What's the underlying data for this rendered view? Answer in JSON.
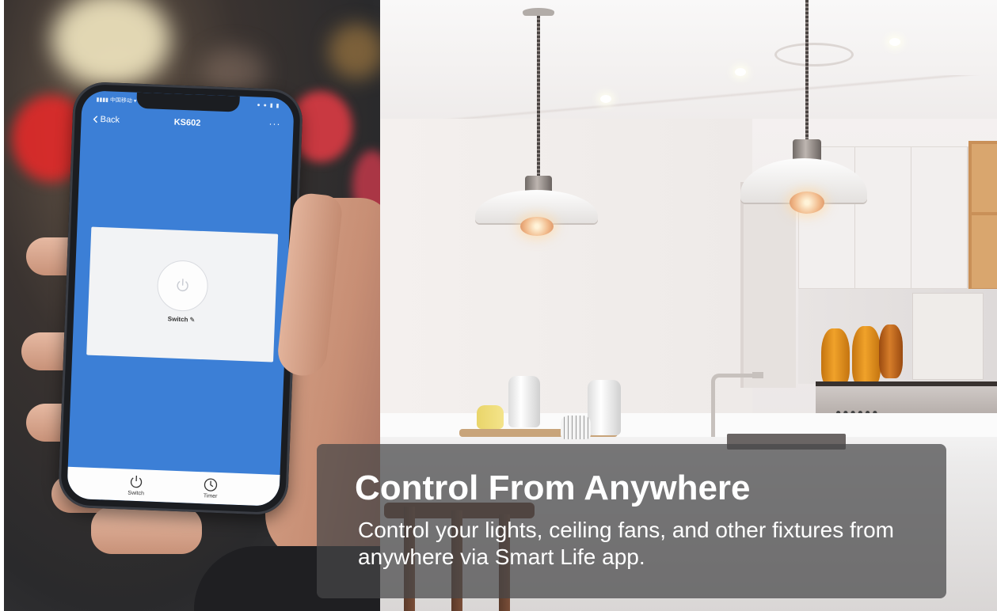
{
  "phone_app": {
    "status_left": "▮▮▮▮ 中国移动 ▾",
    "status_right": "● ● ▮ ▮",
    "back_label": "Back",
    "device_title": "KS602",
    "more_label": "···",
    "switch_label": "Switch",
    "tabs": [
      {
        "label": "Switch",
        "icon": "power-icon"
      },
      {
        "label": "Timer",
        "icon": "clock-icon"
      }
    ],
    "accent_color": "#3c7fd6"
  },
  "caption": {
    "title": "Control From Anywhere",
    "body": "Control your lights, ceiling fans, and other fixtures from anywhere via Smart Life app."
  }
}
